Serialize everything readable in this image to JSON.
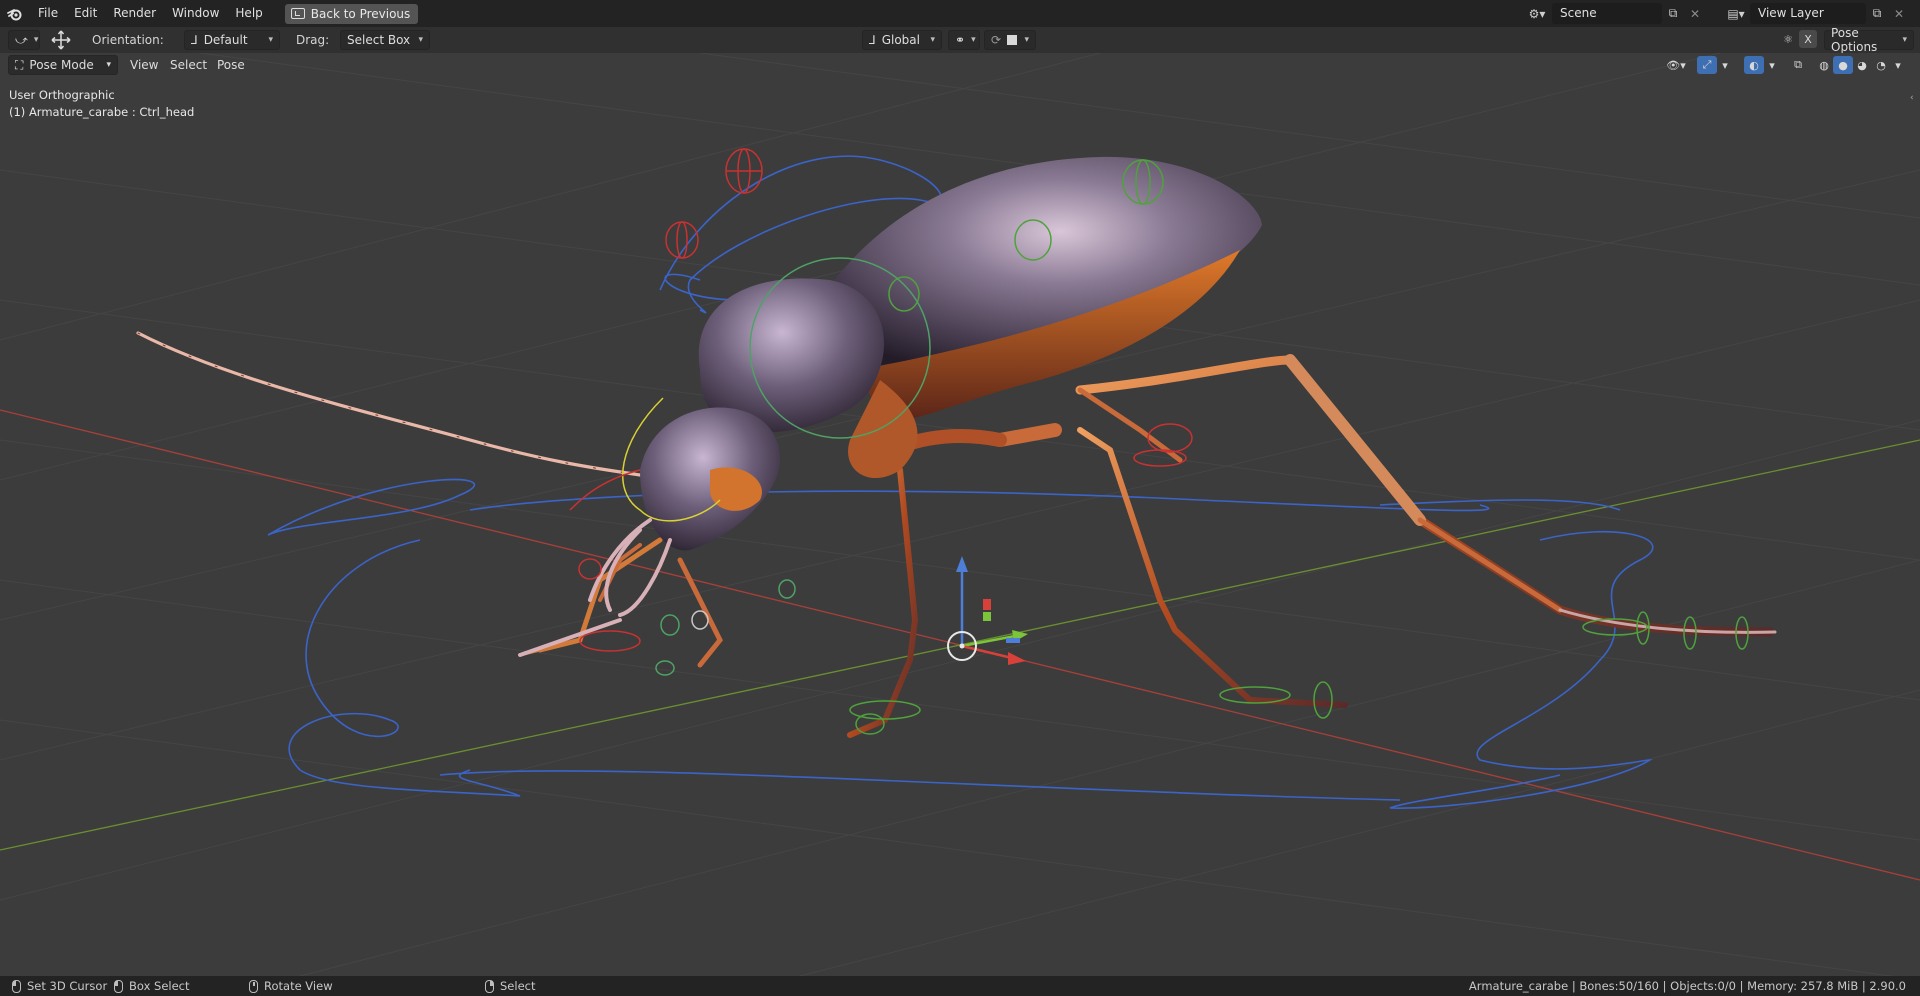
{
  "menubar": {
    "items": [
      "File",
      "Edit",
      "Render",
      "Window",
      "Help"
    ],
    "back_button": "Back to Previous",
    "scene_name": "Scene",
    "view_layer": "View Layer"
  },
  "toolheader": {
    "orientation_label": "Orientation:",
    "orientation_value": "Default",
    "drag_label": "Drag:",
    "drag_value": "Select Box",
    "transform_space": "Global",
    "pose_options": "Pose Options"
  },
  "viewport_header": {
    "mode": "Pose Mode",
    "menus": [
      "View",
      "Select",
      "Pose"
    ],
    "x_mirror": "X"
  },
  "overlay": {
    "view_name": "User Orthographic",
    "active_object": "(1) Armature_carabe : Ctrl_head"
  },
  "statusbar": {
    "left_click": "Set 3D Cursor",
    "drag": "Box Select",
    "middle": "Rotate View",
    "right": "Select",
    "info": "Armature_carabe | Bones:50/160 | Objects:0/0 | Memory: 257.8 MiB | 2.90.0"
  },
  "colors": {
    "x_axis": "#c0463f",
    "y_axis": "#6f9a30",
    "bone_curve": "#3b64c8",
    "control_red": "#c83232",
    "control_green": "#4fa23c",
    "control_yellow": "#d8d232",
    "beetle_shell": "#7d6e86",
    "beetle_leg": "#c85a1e"
  },
  "icons": [
    "blender-logo-icon",
    "move-tool-icon",
    "snap-icon",
    "proportional-icon",
    "visibility-icon",
    "gizmo-icon",
    "overlay-icon",
    "xray-icon",
    "shading-wireframe-icon",
    "shading-solid-icon",
    "shading-material-icon",
    "shading-rendered-icon"
  ]
}
